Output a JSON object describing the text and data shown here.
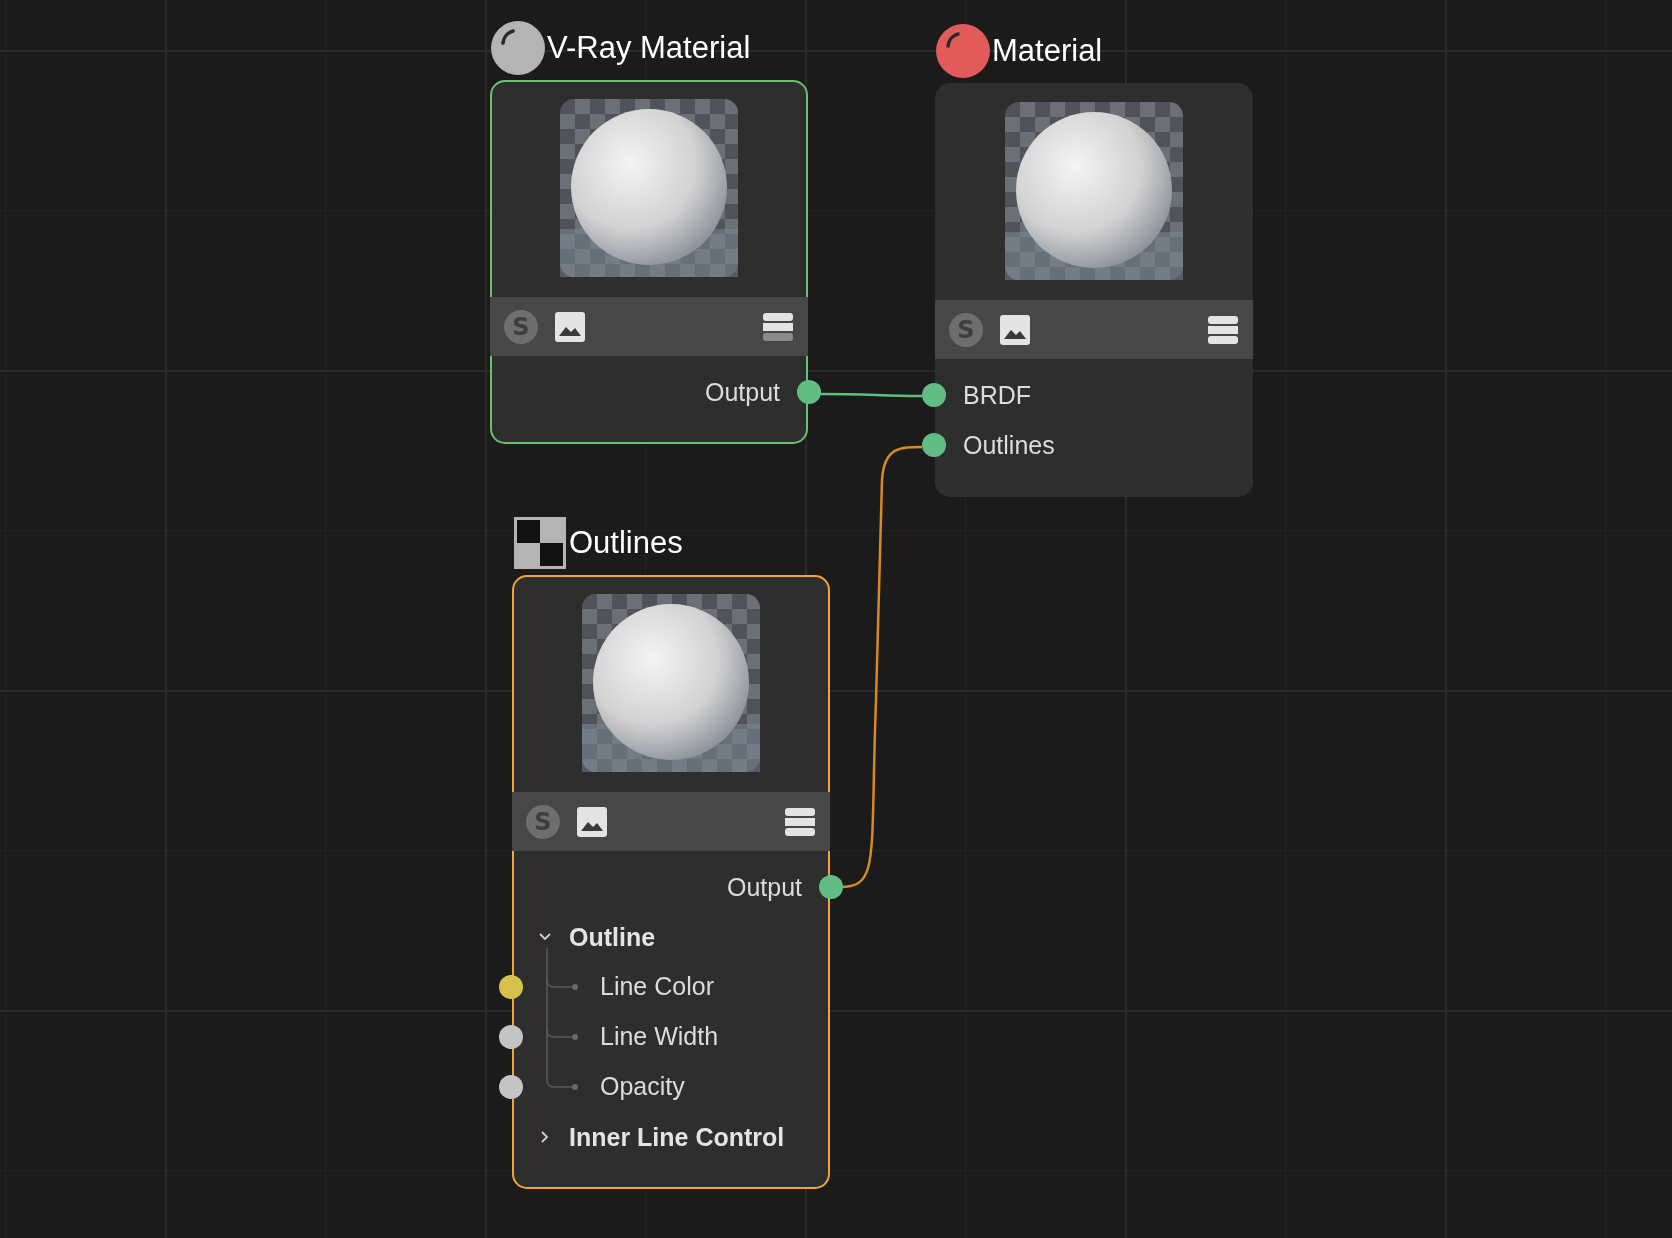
{
  "nodes": [
    {
      "title": "V-Ray Material",
      "icon": {
        "kind": "sphere",
        "color": "#b4b4b4"
      },
      "color": "#6abf72",
      "toolbar": {
        "badge": "S"
      },
      "outputs": [
        {
          "label": "Output"
        }
      ]
    },
    {
      "title": "Material",
      "icon": {
        "kind": "sphere",
        "color": "#e35a5a"
      },
      "toolbar": {
        "badge": "S"
      },
      "inputs": [
        {
          "label": "BRDF",
          "color": "#62bd85"
        },
        {
          "label": "Outlines",
          "color": "#62bd85"
        }
      ]
    },
    {
      "title": "Outlines",
      "icon": {
        "kind": "checker",
        "color": "#b4b4b4"
      },
      "color": "#f2a33a",
      "toolbar": {
        "badge": "S"
      },
      "outputs": [
        {
          "label": "Output"
        }
      ],
      "params": [
        {
          "label": "Outline",
          "expanded": true,
          "children": [
            {
              "label": "Line Color",
              "color": "#d6c24a"
            },
            {
              "label": "Line Width",
              "color": "#c4c4c4"
            },
            {
              "label": "Opacity",
              "color": "#c4c4c4"
            }
          ]
        },
        {
          "label": "Inner Line Control",
          "expanded": false
        }
      ]
    }
  ],
  "connections": [
    {
      "color": "#5fbf7f"
    },
    {
      "color": "#d98a1e"
    }
  ]
}
